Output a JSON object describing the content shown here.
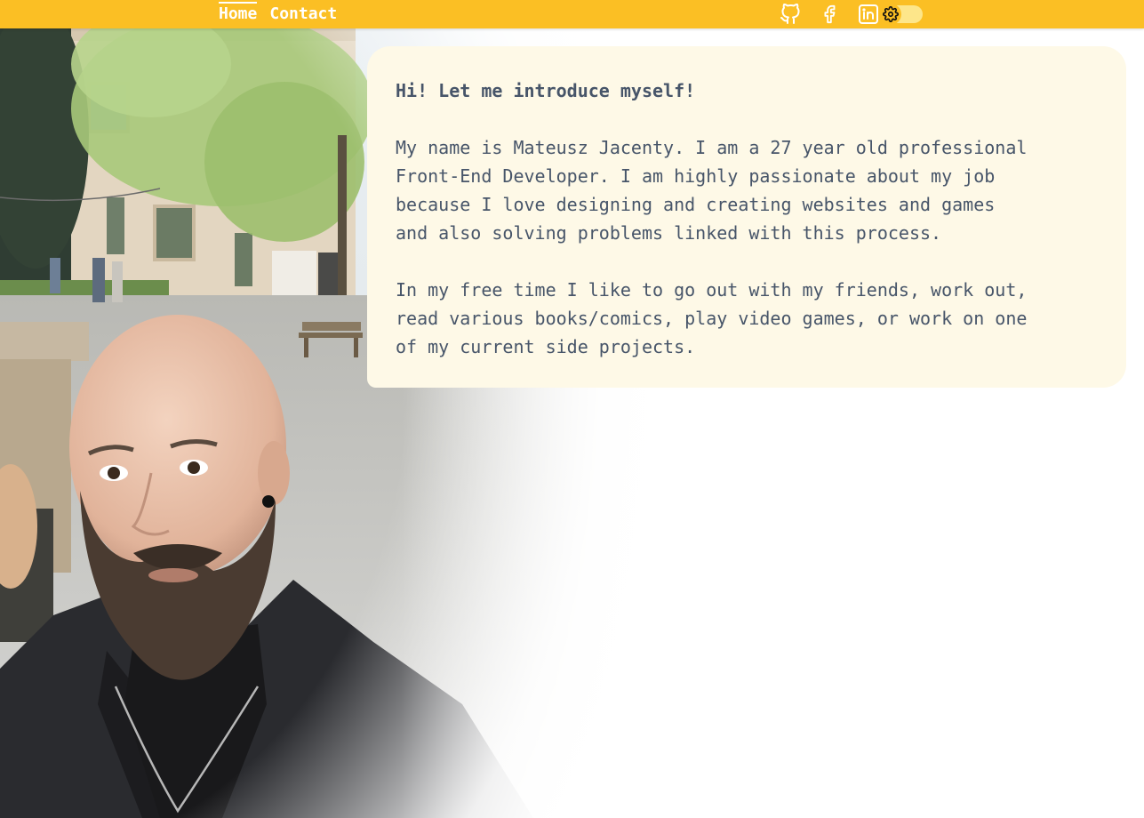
{
  "nav": {
    "items": [
      {
        "label": "Home",
        "active": true
      },
      {
        "label": "Contact",
        "active": false
      }
    ]
  },
  "social": {
    "icons": [
      "github-icon",
      "facebook-icon",
      "linkedin-icon"
    ]
  },
  "theme_toggle": {
    "icon": "gear-icon",
    "state": "light"
  },
  "bio": {
    "title": "Hi! Let me introduce myself!",
    "paragraph_1": "My name is Mateusz Jacenty. I am a 27 year old professional\nFront-End Developer. I am highly passionate about my job\nbecause I love designing and creating websites and games\nand also solving problems linked with this process.",
    "paragraph_2": "In my free time I like to go out with my friends, work out,\nread various books/comics, play video games, or work on one\nof my current side projects."
  },
  "colors": {
    "topbar": "#fbbf24",
    "card": "#fef9e7",
    "text": "#475569",
    "nav_text": "#ffffff"
  }
}
